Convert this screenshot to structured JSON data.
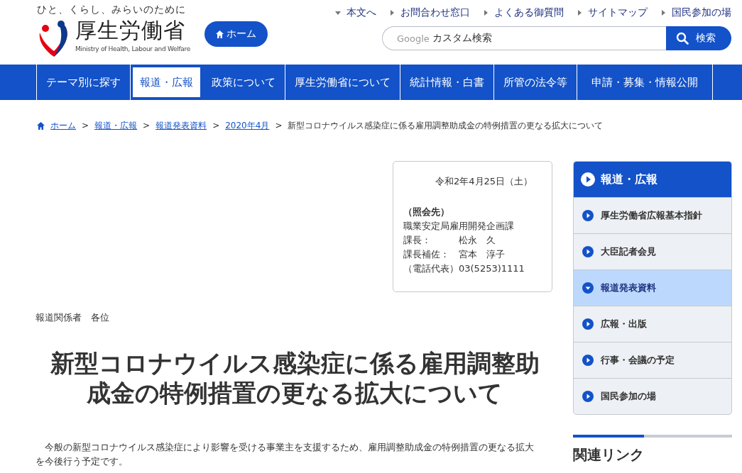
{
  "header": {
    "tagline": "ひと、くらし、みらいのために",
    "logo_name": "厚生労働省",
    "logo_subtitle": "Ministry of Health, Labour and Welfare",
    "home_button": "ホーム",
    "utility_links": [
      "本文へ",
      "お問合わせ窓口",
      "よくある御質問",
      "サイトマップ",
      "国民参加の場"
    ],
    "search": {
      "brand": "Google",
      "placeholder": "カスタム検索",
      "button": "検索"
    }
  },
  "nav": [
    {
      "label": "テーマ別に探す",
      "selected": false
    },
    {
      "label": "報道・広報",
      "selected": true
    },
    {
      "label": "政策について",
      "selected": false
    },
    {
      "label": "厚生労働省について",
      "selected": false
    },
    {
      "label": "統計情報・白書",
      "selected": false
    },
    {
      "label": "所管の法令等",
      "selected": false
    },
    {
      "label": "申請・募集・情報公開",
      "selected": false
    }
  ],
  "breadcrumb": {
    "links": [
      {
        "label": "ホーム",
        "separator": ">"
      },
      {
        "label": "報道・広報",
        "separator": ">"
      },
      {
        "label": "報道発表資料",
        "separator": ">"
      },
      {
        "label": "2020年4月",
        "separator": ">"
      }
    ],
    "current": "新型コロナウイルス感染症に係る雇用調整助成金の特例措置の更なる拡大について"
  },
  "contact_box": [
    {
      "kind": "date",
      "text": "令和2年4月25日（土）"
    },
    {
      "kind": "heading",
      "text": "（照会先）"
    },
    {
      "kind": "line",
      "text": "職業安定局雇用開発企画課"
    },
    {
      "kind": "line",
      "text": "課長：　　　松永　久"
    },
    {
      "kind": "line",
      "text": "課長補佐：　宮本　淳子"
    },
    {
      "kind": "line",
      "text": "（電話代表）03(5253)1111"
    }
  ],
  "addressee": "報道関係者　各位",
  "title": "新型コロナウイルス感染症に係る雇用調整助成金の特例措置の更なる拡大について",
  "body": "　今般の新型コロナウイルス感染症により影響を受ける事業主を支援するため、雇用調整助成金の特例措置の更なる拡大を今後行う予定です。",
  "sidebar": {
    "title": "報道・広報",
    "items": [
      {
        "label": "厚生労働省広報基本指針",
        "selected": false
      },
      {
        "label": "大臣記者会見",
        "selected": false
      },
      {
        "label": "報道発表資料",
        "selected": true
      },
      {
        "label": "広報・出版",
        "selected": false
      },
      {
        "label": "行事・会議の予定",
        "selected": false
      },
      {
        "label": "国民参加の場",
        "selected": false
      }
    ]
  },
  "related_links": {
    "title": "関連リンク"
  }
}
